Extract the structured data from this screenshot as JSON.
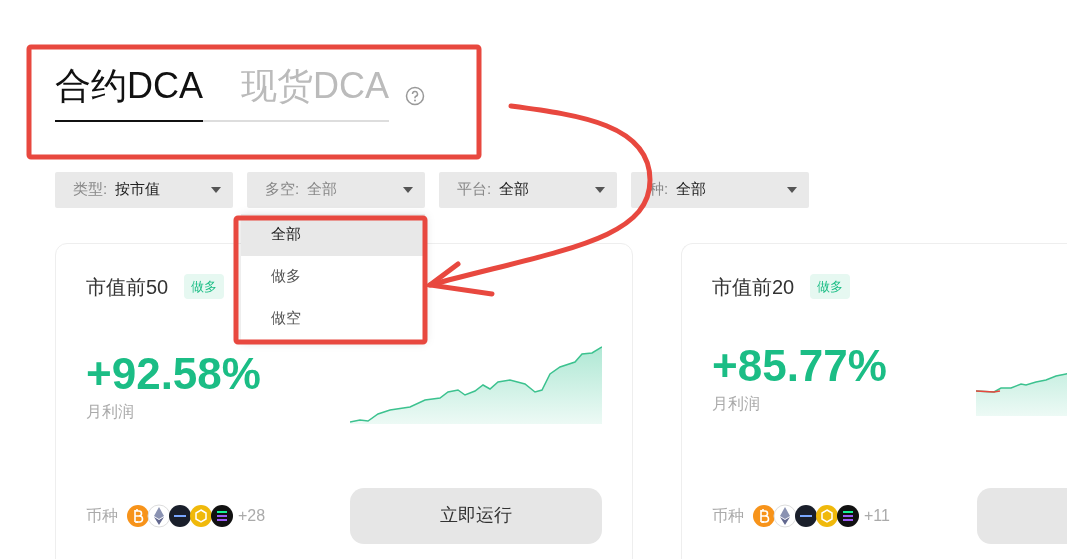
{
  "tabs": [
    {
      "label": "合约DCA",
      "selected": true
    },
    {
      "label": "现货DCA",
      "selected": false
    }
  ],
  "filters": [
    {
      "label": "类型:",
      "value": "按市值",
      "expanded": false
    },
    {
      "label": "多空:",
      "value": "全部",
      "expanded": true,
      "options": [
        {
          "label": "全部",
          "selected": true
        },
        {
          "label": "做多",
          "selected": false
        },
        {
          "label": "做空",
          "selected": false
        }
      ]
    },
    {
      "label": "平台:",
      "value": "全部",
      "expanded": false
    },
    {
      "label": "种:",
      "value": "全部",
      "expanded": false
    }
  ],
  "cards": [
    {
      "title": "市值前50",
      "tag": "做多",
      "profit": "+92.58%",
      "profit_label": "月利润",
      "coins_label": "币种",
      "coins_more": "+28",
      "button": "立即运行"
    },
    {
      "title": "市值前20",
      "tag": "做多",
      "profit": "+85.77%",
      "profit_label": "月利润",
      "coins_label": "币种",
      "coins_more": "+11"
    }
  ]
}
